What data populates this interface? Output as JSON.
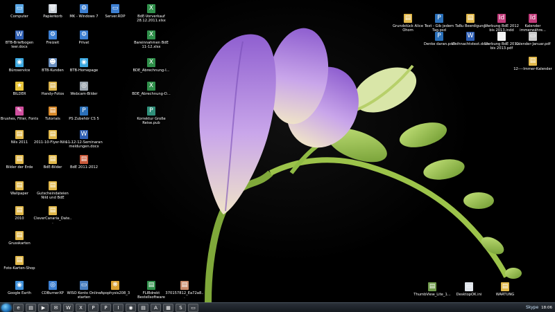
{
  "desktop": {
    "icons": [
      {
        "label": "Computer",
        "icon": "computer-icon",
        "color": "#5aa7e6",
        "glyph": "▭"
      },
      {
        "label": "Papierkorb",
        "icon": "recycle-bin-icon",
        "color": "#c8d0d8",
        "glyph": "🗑"
      },
      {
        "label": "MK - Windows 7",
        "icon": "shortcut-icon",
        "color": "#3d7fd1",
        "glyph": "⚙"
      },
      {
        "label": "Server.RDP",
        "icon": "remote-desktop-icon",
        "color": "#3d7fd1",
        "glyph": "▭"
      },
      {
        "label": "BdE-Vorverkauf 28.12.2011.xlsx",
        "icon": "excel-file-icon",
        "color": "#2f8f4a",
        "glyph": "X"
      },
      {
        "label": "BTB-Briefbogen leer.docx",
        "icon": "word-file-icon",
        "color": "#2f5fb4",
        "glyph": "W"
      },
      {
        "label": "Freizeit",
        "icon": "shortcut-icon",
        "color": "#3d7fd1",
        "glyph": "⚙"
      },
      {
        "label": "Privat",
        "icon": "shortcut-icon",
        "color": "#3d7fd1",
        "glyph": "⚙"
      },
      {
        "label": "Bareinnahmen BdE 11-12.xlsx",
        "icon": "excel-file-icon",
        "color": "#2f8f4a",
        "glyph": "X"
      },
      {
        "label": "Büroservice",
        "icon": "globe-icon",
        "color": "#3da8e0",
        "glyph": "◉"
      },
      {
        "label": "BTB-Kunden",
        "icon": "users-icon",
        "color": "#6a8fbf",
        "glyph": "☻"
      },
      {
        "label": "BTB-Homepage",
        "icon": "globe-icon",
        "color": "#3da8e0",
        "glyph": "◉"
      },
      {
        "label": "BDE_Abrechnung-I...",
        "icon": "excel-file-icon",
        "color": "#2f8f4a",
        "glyph": "X"
      },
      {
        "label": "BILDER",
        "icon": "star-icon",
        "color": "#e8c53a",
        "glyph": "★"
      },
      {
        "label": "Handy-Fotos",
        "icon": "photo-folder-icon",
        "color": "#d9b24a",
        "glyph": "▤"
      },
      {
        "label": "Webcam-Bilder",
        "icon": "webcam-icon",
        "color": "#9aa4ae",
        "glyph": "◎"
      },
      {
        "label": "BDE_Abrechnung-D...",
        "icon": "excel-file-icon",
        "color": "#2f8f4a",
        "glyph": "X"
      },
      {
        "label": "Brushes, Filter, Fonts",
        "icon": "brush-icon",
        "color": "#d04f9e",
        "glyph": "✎"
      },
      {
        "label": "Tutorials",
        "icon": "tutorials-icon",
        "color": "#d98a2a",
        "glyph": "▤"
      },
      {
        "label": "PS Zubehör CS 5",
        "icon": "photoshop-icon",
        "color": "#2a6fb8",
        "glyph": "P"
      },
      {
        "label": "Korrektur Große Reise.pub",
        "icon": "publisher-file-icon",
        "color": "#2f8f7a",
        "glyph": "P"
      },
      {
        "label": "Nils 2011",
        "icon": "folder-icon",
        "color": "#e1b84a",
        "glyph": "▤"
      },
      {
        "label": "2011-10-Flyer-Nils-...",
        "icon": "folder-icon",
        "color": "#e1b84a",
        "glyph": "▤"
      },
      {
        "label": "11-12-12-Seminaran meldungen.docx",
        "icon": "word-file-icon",
        "color": "#2f5fb4",
        "glyph": "W"
      },
      {
        "label": "Bilder der Erde",
        "icon": "folder-icon",
        "color": "#e1b84a",
        "glyph": "▤"
      },
      {
        "label": "BdE-Bilder",
        "icon": "folder-icon",
        "color": "#e1b84a",
        "glyph": "▤"
      },
      {
        "label": "BdE 2011-2012",
        "icon": "folder-red-icon",
        "color": "#c9593a",
        "glyph": "▤"
      },
      {
        "label": "Wallpaper",
        "icon": "folder-icon",
        "color": "#e1b84a",
        "glyph": "▤"
      },
      {
        "label": "Gutscheindateien Nild und BdE",
        "icon": "folder-icon",
        "color": "#e1b84a",
        "glyph": "▤"
      },
      {
        "label": "2010",
        "icon": "folder-icon",
        "color": "#e1b84a",
        "glyph": "▤"
      },
      {
        "label": "CleverCanaria_Date...",
        "icon": "folder-icon",
        "color": "#e1b84a",
        "glyph": "▤"
      },
      {
        "label": "Grusskarten",
        "icon": "folder-icon",
        "color": "#e1b84a",
        "glyph": "▤"
      },
      {
        "label": "Foto-Karten-Shop",
        "icon": "folder-icon",
        "color": "#e1b84a",
        "glyph": "▤"
      },
      {
        "label": "Google Earth",
        "icon": "google-earth-icon",
        "color": "#3d8fd9",
        "glyph": "◉"
      },
      {
        "label": "CDBurnerXP",
        "icon": "cd-burner-icon",
        "color": "#3d7fd1",
        "glyph": "◎"
      },
      {
        "label": "WISO Konto Online starten",
        "icon": "wiso-icon",
        "color": "#4a7fc0",
        "glyph": "▭"
      },
      {
        "label": "Apophysis208_3",
        "icon": "apophysis-icon",
        "color": "#d9a030",
        "glyph": "❋"
      },
      {
        "label": "FLIBdrekt Bestellsoftware",
        "icon": "order-software-icon",
        "color": "#2f8f4a",
        "glyph": "▤"
      },
      {
        "label": "370157812_Ea72a8...",
        "icon": "image-file-icon",
        "color": "#c98a6a",
        "glyph": "▤"
      },
      {
        "label": "Grundstück Alice Ohom",
        "icon": "folder-icon",
        "color": "#e1b84a",
        "glyph": "▤"
      },
      {
        "label": "Text - Gib jedem Tag.psd",
        "icon": "photoshop-file-icon",
        "color": "#2a6fb8",
        "glyph": "P"
      },
      {
        "label": "TaRu Beerdigung",
        "icon": "folder-icon",
        "color": "#e1b84a",
        "glyph": "▤"
      },
      {
        "label": "Werbung BdE 2012 bis 2013.indd",
        "icon": "indesign-file-icon",
        "color": "#c13a7a",
        "glyph": "Id"
      },
      {
        "label": "Kalender immerwähre...",
        "icon": "indesign-file-icon",
        "color": "#c13a7a",
        "glyph": "Id"
      },
      {
        "label": "Denke daran.psd",
        "icon": "photoshop-file-icon",
        "color": "#2a6fb8",
        "glyph": "P"
      },
      {
        "label": "Weihnachtstext.docx",
        "icon": "word-file-icon",
        "color": "#2f5fb4",
        "glyph": "W"
      },
      {
        "label": "Werbung BdE 2012 bis 2013.pdf",
        "icon": "pdf-file-icon",
        "color": "#f2f2f2",
        "glyph": "▭"
      },
      {
        "label": "Kalender-Januar.pdf",
        "icon": "pdf-file-icon",
        "color": "#c9c9c9",
        "glyph": "▭"
      },
      {
        "label": "12----Immer-Kalender",
        "icon": "folder-icon",
        "color": "#e1b84a",
        "glyph": "▤"
      },
      {
        "label": "ThumbView_Lite_1...",
        "icon": "thumbview-icon",
        "color": "#6f9a4a",
        "glyph": "▤"
      },
      {
        "label": "DesktopOK.ini",
        "icon": "ini-file-icon",
        "color": "#dfe4ea",
        "glyph": "▭"
      },
      {
        "label": "WARTUNG",
        "icon": "folder-icon",
        "color": "#e1b84a",
        "glyph": "▤"
      }
    ]
  },
  "taskbar": {
    "items": [
      {
        "icon": "ie-icon",
        "glyph": "e"
      },
      {
        "icon": "explorer-icon",
        "glyph": "▤"
      },
      {
        "icon": "media-player-icon",
        "glyph": "▶"
      },
      {
        "icon": "outlook-icon",
        "glyph": "✉"
      },
      {
        "icon": "word-icon",
        "glyph": "W"
      },
      {
        "icon": "excel-icon",
        "glyph": "X"
      },
      {
        "icon": "publisher-icon",
        "glyph": "P"
      },
      {
        "icon": "photoshop-icon",
        "glyph": "P"
      },
      {
        "icon": "indesign-icon",
        "glyph": "I"
      },
      {
        "icon": "firefox-icon",
        "glyph": "◉"
      },
      {
        "icon": "folder-icon",
        "glyph": "▤"
      },
      {
        "icon": "acrobat-icon",
        "glyph": "A"
      },
      {
        "icon": "calculator-icon",
        "glyph": "▦"
      },
      {
        "icon": "skype-icon",
        "glyph": "S"
      },
      {
        "icon": "remote-icon",
        "glyph": "▭"
      }
    ],
    "tray": {
      "app_label": "Skype",
      "clock": "18:06"
    }
  }
}
